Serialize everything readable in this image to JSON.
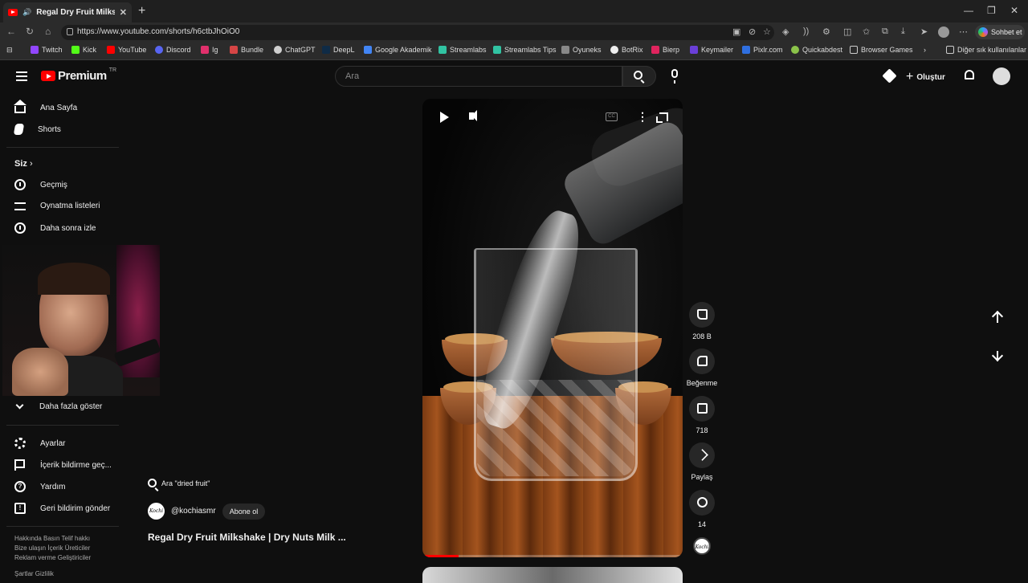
{
  "browser": {
    "tab_title": "Regal Dry Fruit Milkshake |",
    "tab_close": "✕",
    "new_tab": "+",
    "url": "https://www.youtube.com/shorts/h6ctbJhOiO0",
    "copilot_label": "Sohbet et",
    "bookmarks": [
      "Twitch",
      "Kick",
      "YouTube",
      "Discord",
      "Ig",
      "Bundle",
      "ChatGPT",
      "DeepL",
      "Google Akademik",
      "Streamlabs",
      "Streamlabs Tips",
      "Oyuneks",
      "BotRix",
      "Bierp",
      "Keymailer",
      "Pixlr.com",
      "Quickabdest",
      "Browser Games"
    ],
    "other_bookmarks": "Diğer sık kullanılanlar"
  },
  "header": {
    "logo_word": "Premium",
    "logo_region": "TR",
    "search_placeholder": "Ara",
    "create_label": "Oluştur",
    "create_plus": "+"
  },
  "sidebar": {
    "items_top": [
      {
        "label": "Ana Sayfa",
        "icon": "home-icon"
      },
      {
        "label": "Shorts",
        "icon": "shorts-icon"
      }
    ],
    "you_header": "Siz",
    "items_you": [
      {
        "label": "Geçmiş",
        "icon": "history-icon"
      },
      {
        "label": "Oynatma listeleri",
        "icon": "playlists-icon"
      },
      {
        "label": "Daha sonra izle",
        "icon": "watch-later-icon"
      }
    ],
    "show_more": "Daha fazla göster",
    "items_bottom": [
      {
        "label": "Ayarlar",
        "icon": "settings-icon"
      },
      {
        "label": "İçerik bildirme geç...",
        "icon": "flag-icon"
      },
      {
        "label": "Yardım",
        "icon": "help-icon"
      },
      {
        "label": "Geri bildirim gönder",
        "icon": "feedback-icon"
      }
    ],
    "footer_line1": "Hakkında   Basın   Telif hakkı",
    "footer_line2": "Bize ulaşın   İçerik Üreticiler",
    "footer_line3": "Reklam verme   Geliştiriciler",
    "footer_line4": "Şartlar   Gizlilik"
  },
  "video": {
    "search_chip": "Ara \"dried fruit\"",
    "channel_handle": "@kochiasmr",
    "channel_avatar_text": "Kochi",
    "subscribe_label": "Abone ol",
    "title": "Regal Dry Fruit Milkshake | Dry Nuts Milk ...",
    "progress_fraction": 0.14,
    "more_glyph": "⋮",
    "cc_glyph": "CC"
  },
  "actions": {
    "likes": "208 B",
    "dislike_label": "Beğenme",
    "comments": "718",
    "share_label": "Paylaş",
    "remixes": "14"
  },
  "colors": {
    "youtube_red": "#ff0000",
    "background": "#0f0f0f",
    "chip_bg": "#272727"
  }
}
